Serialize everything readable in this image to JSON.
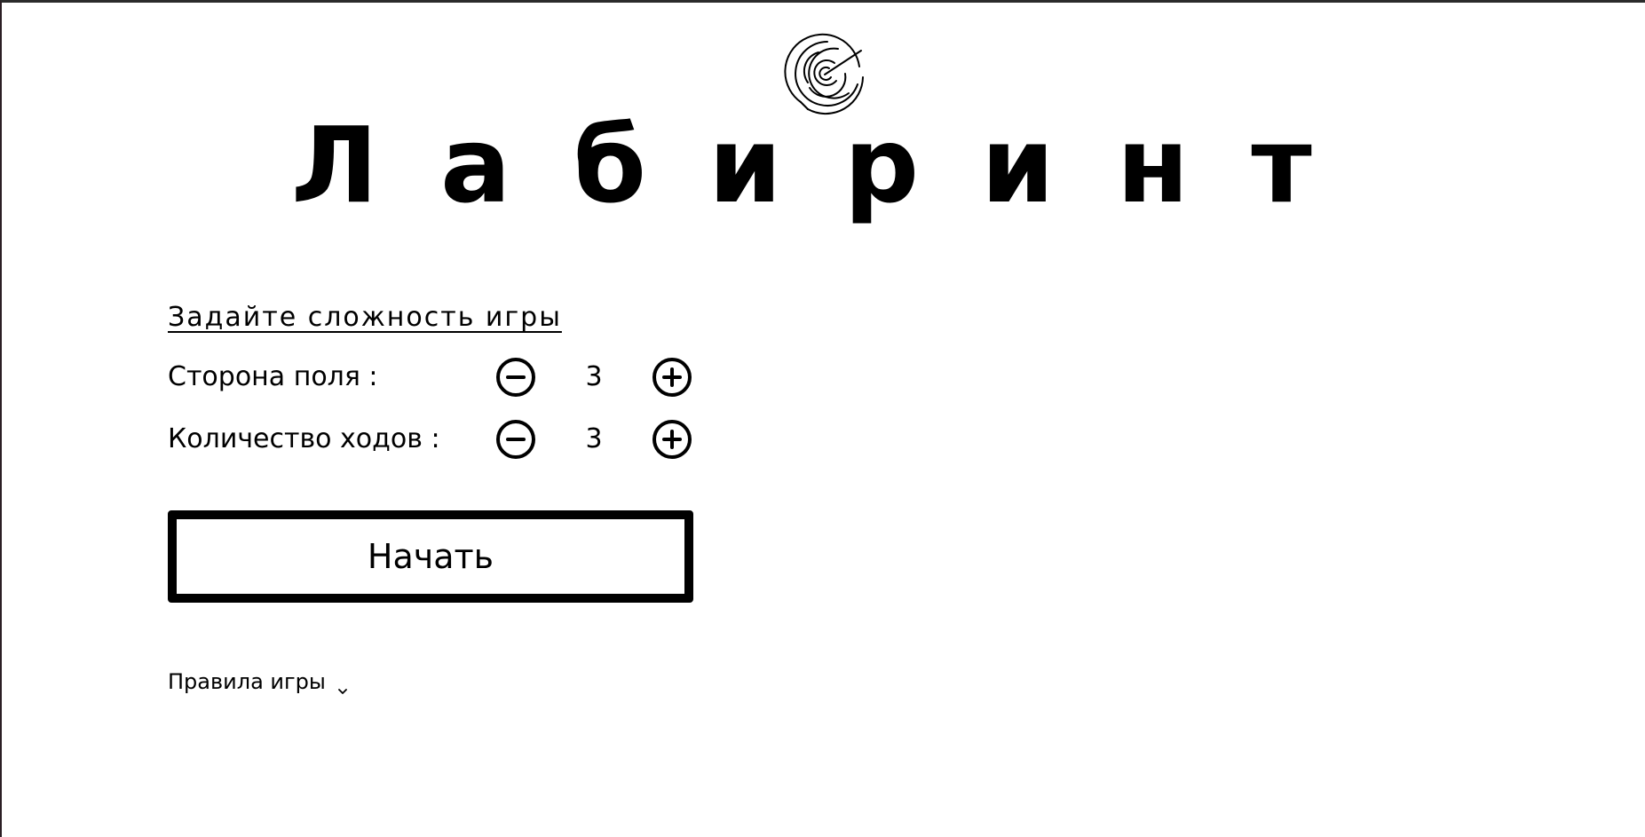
{
  "header": {
    "logo_icon": "maze-logo-icon",
    "title": "Лабиринт"
  },
  "difficulty": {
    "heading": "Задайте сложность игры",
    "settings": [
      {
        "label": "Сторона поля :",
        "value": "3",
        "decrement_icon": "minus-circle-icon",
        "increment_icon": "plus-circle-icon"
      },
      {
        "label": "Количество ходов :",
        "value": "3",
        "decrement_icon": "minus-circle-icon",
        "increment_icon": "plus-circle-icon"
      }
    ]
  },
  "start_button": {
    "label": "Начать"
  },
  "rules": {
    "label": "Правила игры",
    "icon": "chevron-down-icon"
  },
  "colors": {
    "background": "#ffffff",
    "foreground": "#000000"
  }
}
